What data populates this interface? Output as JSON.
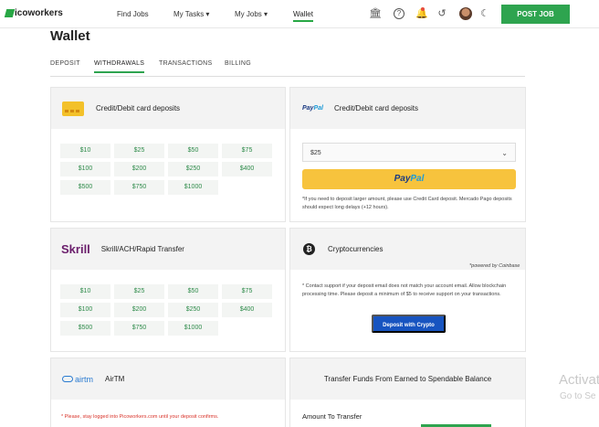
{
  "topnav": {
    "logo_text": "icoworkers",
    "links": [
      "Find Jobs",
      "My Tasks ▾",
      "My Jobs ▾",
      "Wallet"
    ],
    "post_job_label": "POST JOB",
    "icons": [
      "bank-icon",
      "help-icon",
      "bell-icon",
      "history-icon",
      "avatar",
      "moon-icon"
    ]
  },
  "page": {
    "title": "Wallet",
    "tabs": [
      "DEPOSIT",
      "WITHDRAWALS",
      "TRANSACTIONS",
      "BILLING"
    ],
    "active_tab": "WITHDRAWALS"
  },
  "card_deposit": {
    "title": "Credit/Debit card deposits",
    "amounts": [
      "$10",
      "$25",
      "$50",
      "$75",
      "$100",
      "$200",
      "$250",
      "$400",
      "$500",
      "$750",
      "$1000"
    ]
  },
  "paypal": {
    "logo_a": "Pay",
    "logo_b": "Pal",
    "title": "Credit/Debit card deposits",
    "selected_amount": "$25",
    "button_a": "Pay",
    "button_b": "Pal",
    "note": "*If you need to deposit larger amount, please use Credit Card deposit. Mercado Pago deposits should expect long delays (+12 hours)."
  },
  "skrill": {
    "logo": "Skrill",
    "title": "Skrill/ACH/Rapid Transfer",
    "amounts": [
      "$10",
      "$25",
      "$50",
      "$75",
      "$100",
      "$200",
      "$250",
      "$400",
      "$500",
      "$750",
      "$1000"
    ]
  },
  "crypto": {
    "title": "Cryptocurrencies",
    "powered_by": "*powered by Coinbase",
    "note": "* Contact support if your deposit email does not match your account email. Allow blockchain processing time. Please deposit a minimum of $5 to receive support on your transactions.",
    "button_label": "Deposit with Crypto"
  },
  "airtm": {
    "logo": "airtm",
    "title": "AirTM",
    "warning": "* Please, stay logged into Picoworkers.com until your deposit confirms."
  },
  "transfer": {
    "title": "Transfer Funds From Earned to Spendable Balance",
    "amount_label": "Amount To Transfer"
  },
  "watermark": {
    "line1": "Activat",
    "line2": "Go to Se"
  }
}
